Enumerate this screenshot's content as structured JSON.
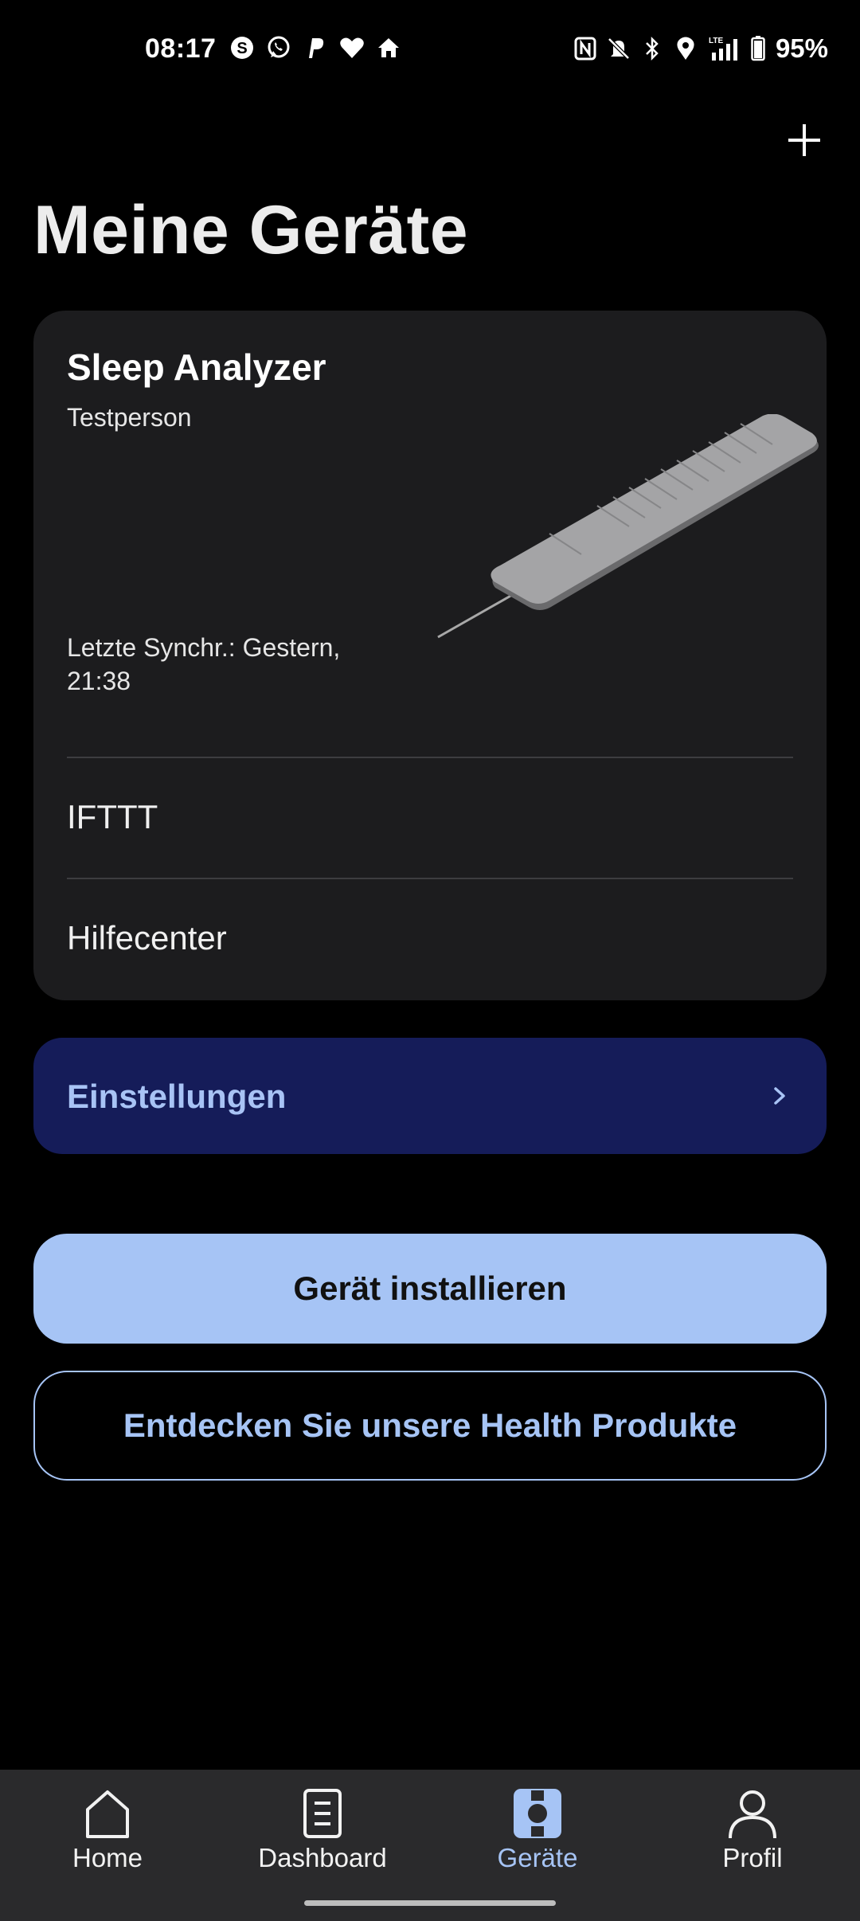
{
  "status_bar": {
    "time": "08:17",
    "left_icons": [
      "skype-icon",
      "whatsapp-icon",
      "paypal-icon",
      "heart-icon",
      "home-icon"
    ],
    "right_icons": [
      "nfc-icon",
      "bell-muted-icon",
      "bluetooth-icon",
      "location-icon",
      "lte-signal-icon",
      "battery-icon"
    ],
    "network": "LTE",
    "battery": "95%"
  },
  "header": {
    "title": "Meine Geräte",
    "add_icon": "plus-icon"
  },
  "device_card": {
    "name": "Sleep Analyzer",
    "owner": "Testperson",
    "last_sync": "Letzte Synchr.: Gestern, 21:38",
    "image": "sleep-analyzer-mat",
    "rows": [
      {
        "label": "IFTTT"
      },
      {
        "label": "Hilfecenter"
      }
    ]
  },
  "settings": {
    "label": "Einstellungen",
    "icon": "chevron-right-icon"
  },
  "buttons": {
    "install": "Gerät installieren",
    "discover": "Entdecken Sie unsere Health Produkte"
  },
  "bottom_nav": {
    "active": "Geräte",
    "items": [
      {
        "label": "Home",
        "icon": "home-icon"
      },
      {
        "label": "Dashboard",
        "icon": "dashboard-icon"
      },
      {
        "label": "Geräte",
        "icon": "devices-icon"
      },
      {
        "label": "Profil",
        "icon": "profile-icon"
      }
    ]
  },
  "colors": {
    "background": "#000000",
    "card": "#1c1c1e",
    "settings_bg": "#151c59",
    "accent": "#a6c4f5",
    "nav_bg": "#2a2a2c"
  }
}
